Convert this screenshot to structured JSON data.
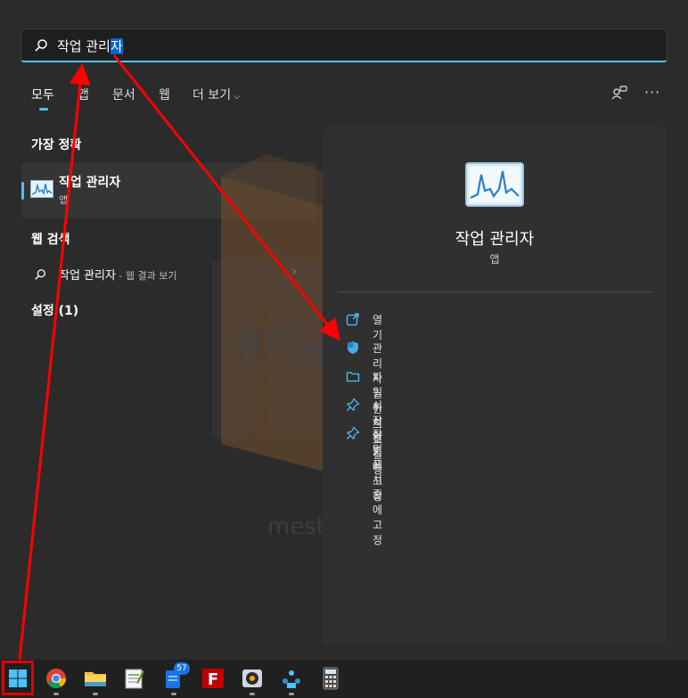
{
  "search": {
    "text_before": "작업 관리",
    "text_selected": "자"
  },
  "tabs": [
    {
      "label": "모두"
    },
    {
      "label": "앱"
    },
    {
      "label": "문서"
    },
    {
      "label": "웹"
    },
    {
      "label": "더 보기"
    }
  ],
  "sections": {
    "best_match": "가장 정확",
    "web_search": "웹 검색",
    "settings": "설정 (1)"
  },
  "best_match": {
    "title": "작업 관리자",
    "subtitle": "앱"
  },
  "web_result": {
    "query": "작업 관리자",
    "suffix": " - 웹 결과 보기"
  },
  "detail": {
    "title": "작업 관리자",
    "subtitle": "앱",
    "actions": [
      {
        "label": "열기",
        "icon": "open-icon"
      },
      {
        "label": "관리자 권한으로 실행",
        "icon": "shield-icon"
      },
      {
        "label": "파일 위치 열기",
        "icon": "folder-icon"
      },
      {
        "label": "시작 화면에 고정",
        "icon": "pin-icon"
      },
      {
        "label": "작업 표시줄에 고정",
        "icon": "pin-icon"
      }
    ]
  },
  "watermark": {
    "title": "썸타임메이 엠",
    "vertical": "Sometime",
    "url": "mestory.com"
  },
  "taskbar": {
    "mail_badge": "57"
  },
  "colors": {
    "accent": "#4cc2ff",
    "annotation": "#ff0000",
    "panel": "#2b2b2b"
  }
}
